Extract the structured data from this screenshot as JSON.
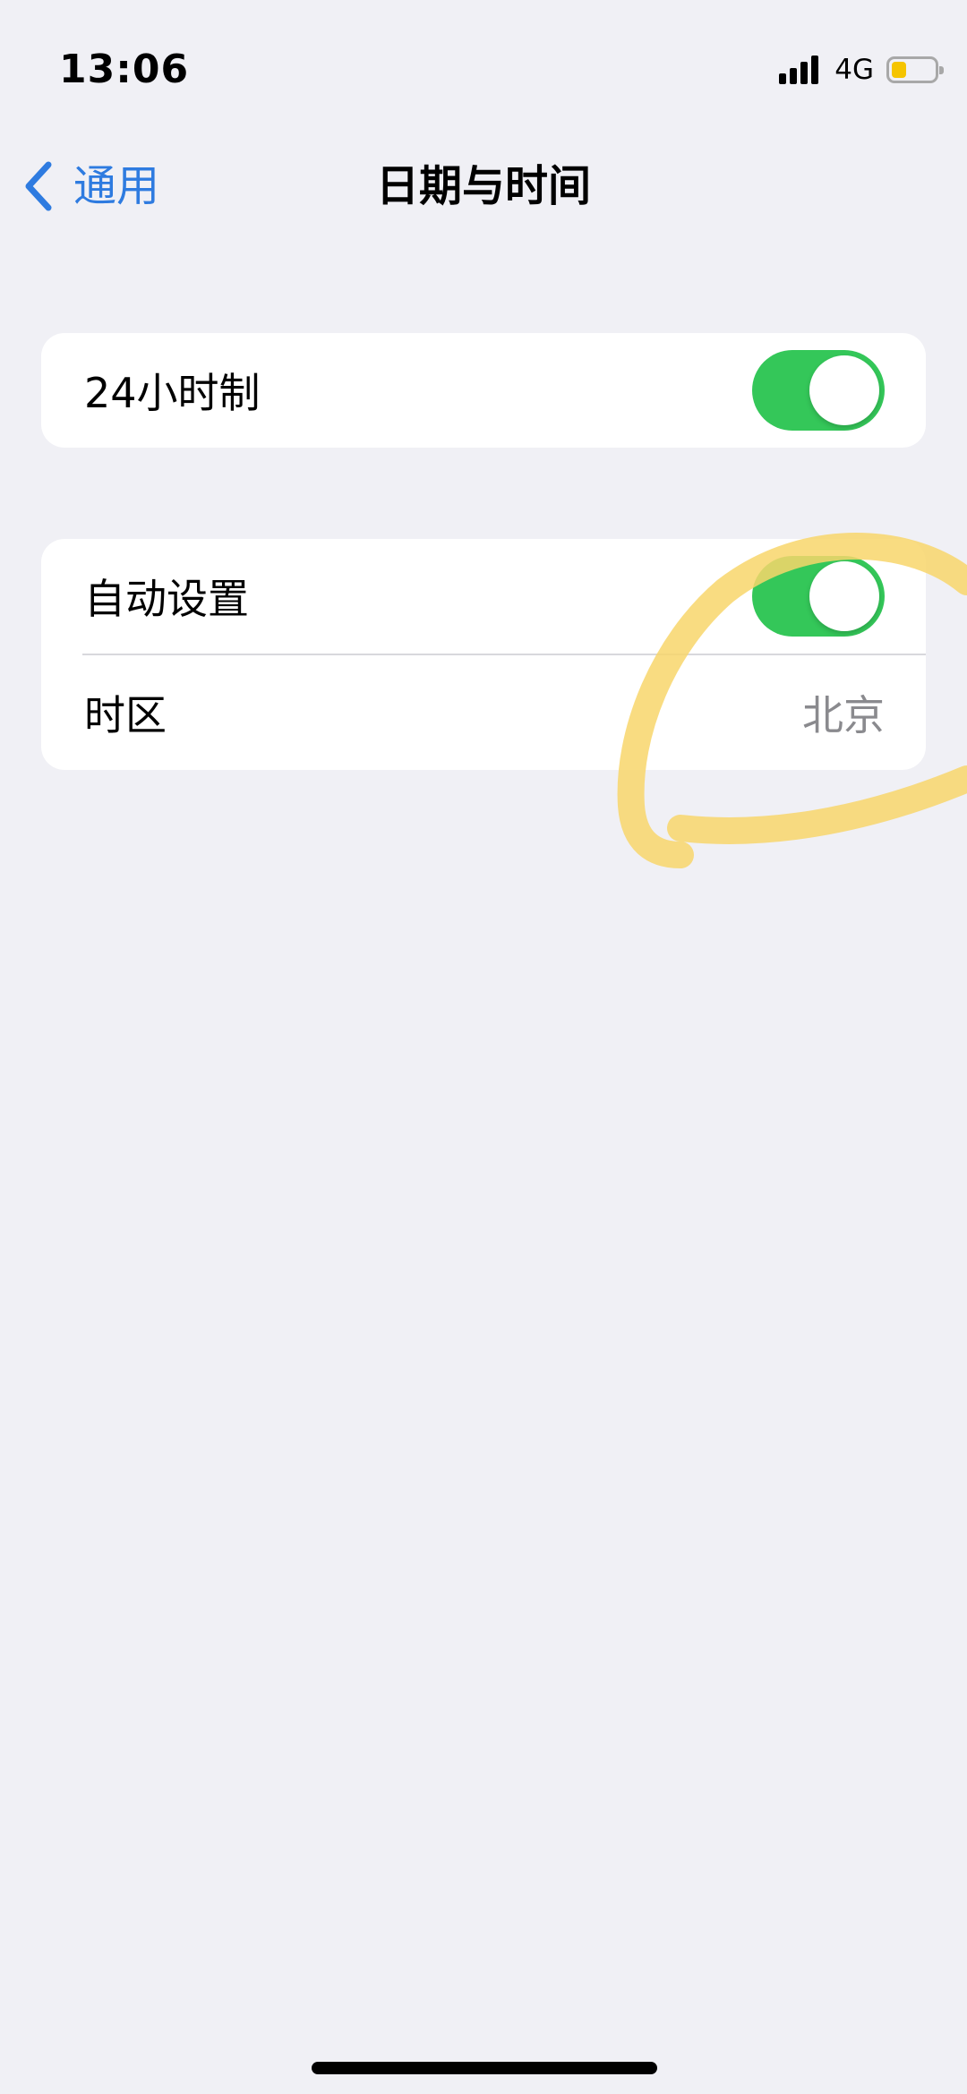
{
  "status_bar": {
    "time": "13:06",
    "network": "4G",
    "signal_icon": "cellular-signal-icon",
    "battery_icon": "battery-icon",
    "battery_color": "#f5c400",
    "battery_level": 0.35
  },
  "nav": {
    "back_label": "通用",
    "back_icon": "chevron-left-icon",
    "title": "日期与时间",
    "accent_color": "#2e7be0"
  },
  "settings": {
    "hour24": {
      "label": "24小时制",
      "enabled": true
    },
    "auto_set": {
      "label": "自动设置",
      "enabled": true
    },
    "time_zone": {
      "label": "时区",
      "value": "北京"
    }
  },
  "colors": {
    "background": "#f0f0f5",
    "toggle_on": "#34c759",
    "annotation": "#f8d66b"
  }
}
